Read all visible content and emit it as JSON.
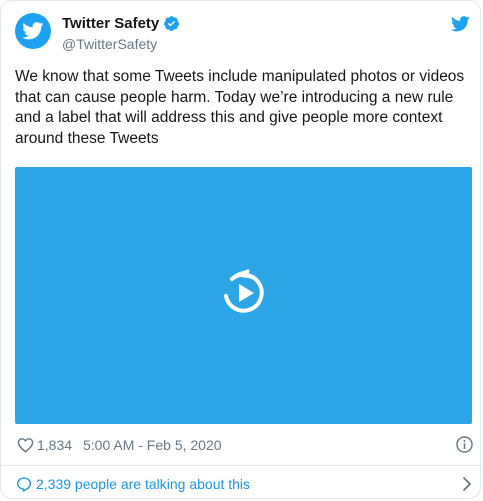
{
  "account": {
    "display_name": "Twitter Safety",
    "handle": "@TwitterSafety",
    "verified": true,
    "avatar_icon": "twitter-bird-icon",
    "brand_color": "#1da1f2"
  },
  "tweet": {
    "text": "We know that some Tweets include manipulated photos or videos that can cause people harm. Today we’re introducing a new rule and a label that will address this and give people more context around these Tweets",
    "media": {
      "type": "video",
      "play_icon": "play-icon",
      "background_color": "#2da5e6"
    }
  },
  "meta": {
    "likes": "1,834",
    "timestamp": "5:00 AM - Feb 5, 2020",
    "like_icon": "heart-icon",
    "info_icon": "info-icon"
  },
  "footer": {
    "talking_text": "2,339 people are talking about this",
    "link_color": "#1b95e0"
  }
}
